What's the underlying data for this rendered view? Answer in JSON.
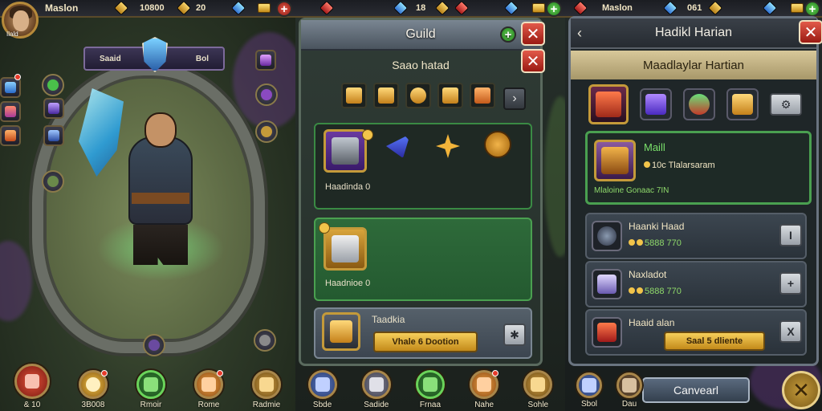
{
  "colors": {
    "gold": "#c49a3a",
    "green_accent": "#4aa050",
    "close_red": "#e25a4a",
    "price_green": "#8ed86a"
  },
  "panel1": {
    "hero_name": "Maslon",
    "avatar_label": "Ilald",
    "hud": {
      "gold_value": "10800",
      "red_gem_value": "20"
    },
    "ribbon_left": "Saaid",
    "ribbon_right": "Bol",
    "nav": [
      {
        "label": "& 10",
        "icon": "heart-icon"
      },
      {
        "label": "3B008",
        "icon": "target-icon"
      },
      {
        "label": "Rmoir",
        "icon": "shield-check-icon"
      },
      {
        "label": "Rome",
        "icon": "fist-icon"
      },
      {
        "label": "Radmie",
        "icon": "helmet-icon"
      }
    ]
  },
  "panel2": {
    "hud": {
      "count": "18"
    },
    "title": "Guild",
    "subtitle": "Saao hatad",
    "card1_label": "Haadinda 0",
    "card2_label": "Haadnioe 0",
    "card3_title": "Taadkia",
    "card3_button": "Vhale 6 Dootion",
    "nav": [
      {
        "label": "Sbde",
        "icon": "sword-icon"
      },
      {
        "label": "Sadide",
        "icon": "axe-icon"
      },
      {
        "label": "Frnaa",
        "icon": "shield-check-icon"
      },
      {
        "label": "Nahe",
        "icon": "fist-icon"
      },
      {
        "label": "Sohle",
        "icon": "helmet-icon"
      }
    ]
  },
  "panel3": {
    "hud": {
      "name": "Maslon",
      "gold_value": "061"
    },
    "title": "Hadikl Harian",
    "band_title": "Maadlaylar Hartian",
    "featured": {
      "name": "Maill",
      "price": "10c Tlalarsaram",
      "footer": "Mlaloine Gonaac 7IN"
    },
    "rows": [
      {
        "name": "Haanki Haad",
        "price": "5888 770",
        "button": "I"
      },
      {
        "name": "Naxladot",
        "price": "5888 770",
        "button": "+"
      },
      {
        "name": "Haaid alan",
        "price": "",
        "button": "X",
        "buy_label": "Saal 5 dliente"
      }
    ],
    "cancel": "Canvearl",
    "nav": [
      {
        "label": "Sbol",
        "icon": "sword-icon"
      },
      {
        "label": "Dau",
        "icon": "axe-icon"
      }
    ]
  }
}
